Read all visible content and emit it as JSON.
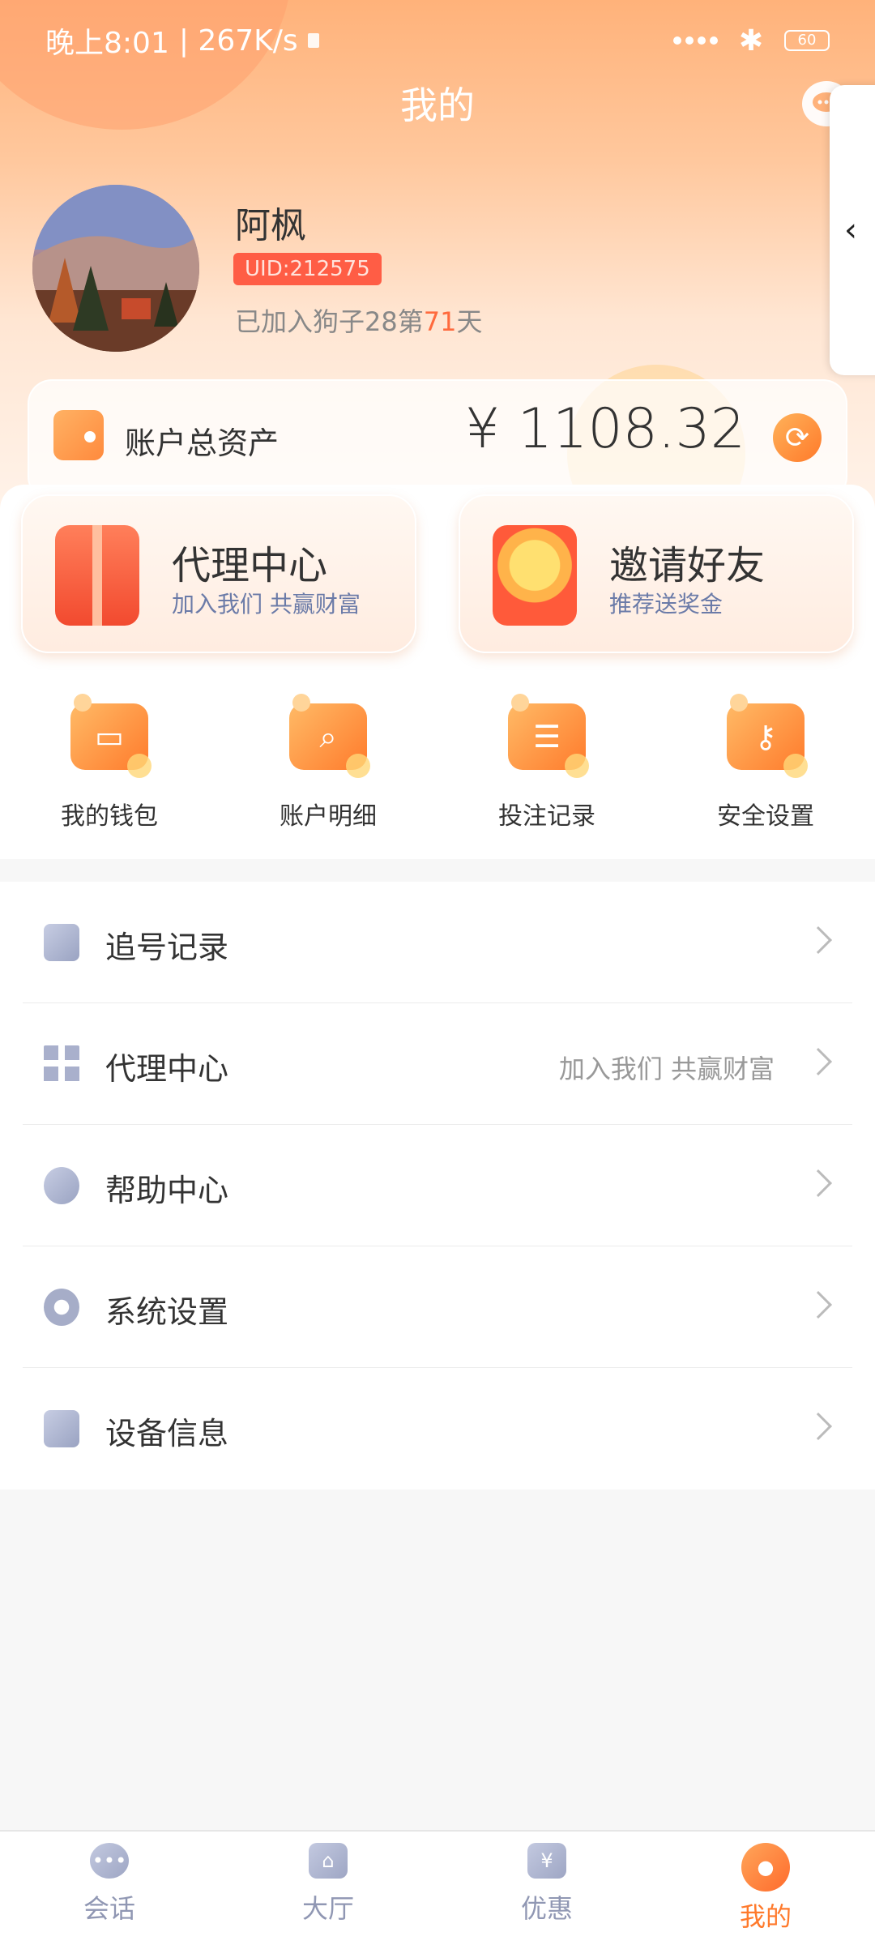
{
  "status_bar": {
    "time": "晚上8:01",
    "speed": "| 267K/s",
    "battery": "60"
  },
  "header": {
    "title": "我的",
    "side_tab_arrow": "‹"
  },
  "profile": {
    "name": "阿枫",
    "uid": "UID:212575",
    "joined_prefix": "已加入狗子28第",
    "joined_days": "71",
    "joined_suffix": "天"
  },
  "assets": {
    "label": "账户总资产",
    "value": "¥ 1108.32"
  },
  "promos": [
    {
      "title": "代理中心",
      "subtitle": "加入我们 共赢财富",
      "icon": "gift-icon"
    },
    {
      "title": "邀请好友",
      "subtitle": "推荐送奖金",
      "icon": "coin-hand-icon"
    }
  ],
  "quick_actions": [
    {
      "label": "我的钱包",
      "icon": "wallet-icon"
    },
    {
      "label": "账户明细",
      "icon": "search-icon"
    },
    {
      "label": "投注记录",
      "icon": "record-icon"
    },
    {
      "label": "安全设置",
      "icon": "key-icon"
    }
  ],
  "menu": [
    {
      "label": "追号记录",
      "note": "",
      "icon": "clipboard-icon"
    },
    {
      "label": "代理中心",
      "note": "加入我们 共赢财富",
      "icon": "qr-code-icon"
    },
    {
      "label": "帮助中心",
      "note": "",
      "icon": "help-icon"
    },
    {
      "label": "系统设置",
      "note": "",
      "icon": "gear-icon"
    },
    {
      "label": "设备信息",
      "note": "",
      "icon": "tablet-icon"
    }
  ],
  "bottom_nav": [
    {
      "label": "会话",
      "icon": "chat-icon",
      "active": false
    },
    {
      "label": "大厅",
      "icon": "hall-icon",
      "active": false
    },
    {
      "label": "优惠",
      "icon": "discount-icon",
      "active": false
    },
    {
      "label": "我的",
      "icon": "profile-icon",
      "active": true
    }
  ],
  "colors": {
    "accent": "#ff7a2c",
    "uid_badge": "#ff5d45",
    "subtitle": "#6b7ba8",
    "nav_inactive": "#9097b3"
  }
}
